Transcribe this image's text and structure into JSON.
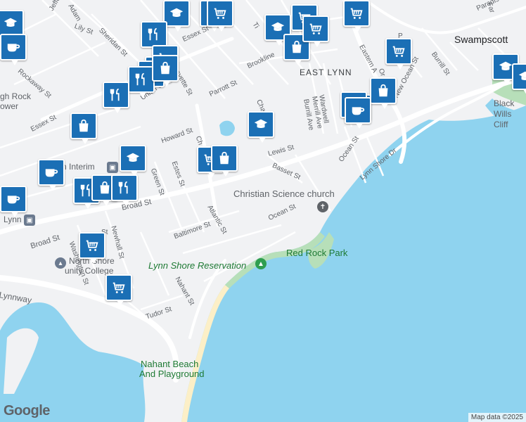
{
  "colors": {
    "water": "#8fd3ef",
    "land": "#f1f2f4",
    "road": "#ffffff",
    "park": "#b7dfb9",
    "beach": "#fcefc7",
    "marker": "#1b6fb5"
  },
  "labels": {
    "swampscott": "Swampscott",
    "east_lynn": "EAST LYNN",
    "black_wills_cliff": "Black\nWills Cliff",
    "high_rock_tower_1": "gh Rock",
    "high_rock_tower_2": "ower",
    "christian_science": "Christian Science church",
    "red_rock_park": "Red Rock Park",
    "lynn_shore_reservation": "Lynn Shore Reservation",
    "nahant_beach": "Nahant Beach",
    "and_playground": "And Playground",
    "north_shore_1": "North Shore",
    "north_shore_2": "unity College",
    "lynn_interim": "n Interim",
    "lynn": "Lynn",
    "lynnway": "Lynnway"
  },
  "streets": {
    "essex_st_top": "Essex St",
    "essex_st_left": "Essex St",
    "lily_st": "Lily St",
    "sheridan_st": "Sheridan St",
    "rockaway_st": "Rockaway St",
    "union_st": "Union St",
    "parrott_st": "Parrott St",
    "brookline_st": "Brookline",
    "howard_st": "Howard St",
    "green_st": "Green St",
    "estes_st": "Estes St",
    "lewis_st": "Lewis St",
    "basset_st": "Basset St",
    "broad_st": "Broad St",
    "broad_st_left": "Broad St",
    "atlantic_st": "Atlantic St",
    "baltimore_st": "Baltimore St",
    "ocean_st": "Ocean St",
    "ocean_st_upper": "Ocean St",
    "lynn_shore_dr": "Lynn Shore Dr",
    "new_ocean_st": "New Ocean St",
    "eastern_ave": "Eastern A",
    "burrill_st": "Burrill St",
    "merrill_ave": "Merrill Ave",
    "burrill_ave": "Burrill Ave",
    "wardwell": "Wardwell",
    "nahant_st": "Nahant St",
    "tudor_st": "Tudor St",
    "newhall_st": "Newhall St",
    "washington_st": "Washington St",
    "chatham": "Cha",
    "chestnut": "Ch",
    "paradise": "Paradise",
    "jefferson": "Jeffe",
    "adams": "Adam",
    "lafayette": "ayette St",
    "fa": "Far",
    "or": "Or",
    "st_small": "St",
    "ti": "Ti",
    "pl": "P"
  },
  "markers": [
    {
      "icon": "school"
    },
    {
      "icon": "grocery"
    },
    {
      "icon": "grocery"
    },
    {
      "icon": "school"
    },
    {
      "icon": "grocery"
    },
    {
      "icon": "restaurant"
    },
    {
      "icon": "coffee"
    },
    {
      "icon": "school"
    },
    {
      "icon": "shopping"
    },
    {
      "icon": "grocery"
    },
    {
      "icon": "grocery"
    },
    {
      "icon": "grocery"
    },
    {
      "icon": "grocery"
    },
    {
      "icon": "restaurant"
    },
    {
      "icon": "shopping"
    },
    {
      "icon": "coffee"
    },
    {
      "icon": "school"
    },
    {
      "icon": "shopping"
    },
    {
      "icon": "grocery"
    },
    {
      "icon": "school"
    },
    {
      "icon": "restaurant"
    },
    {
      "icon": "shopping"
    },
    {
      "icon": "grocery"
    },
    {
      "icon": "shopping"
    },
    {
      "icon": "coffee"
    },
    {
      "icon": "coffee"
    },
    {
      "icon": "grocery"
    },
    {
      "icon": "restaurant"
    },
    {
      "icon": "shopping"
    },
    {
      "icon": "restaurant"
    },
    {
      "icon": "coffee"
    },
    {
      "icon": "grocery"
    },
    {
      "icon": "grocery"
    },
    {
      "icon": "school"
    },
    {
      "icon": "school"
    },
    {
      "icon": "coffee"
    }
  ],
  "footer": {
    "google": "Google",
    "attribution": "Map data ©2025"
  }
}
